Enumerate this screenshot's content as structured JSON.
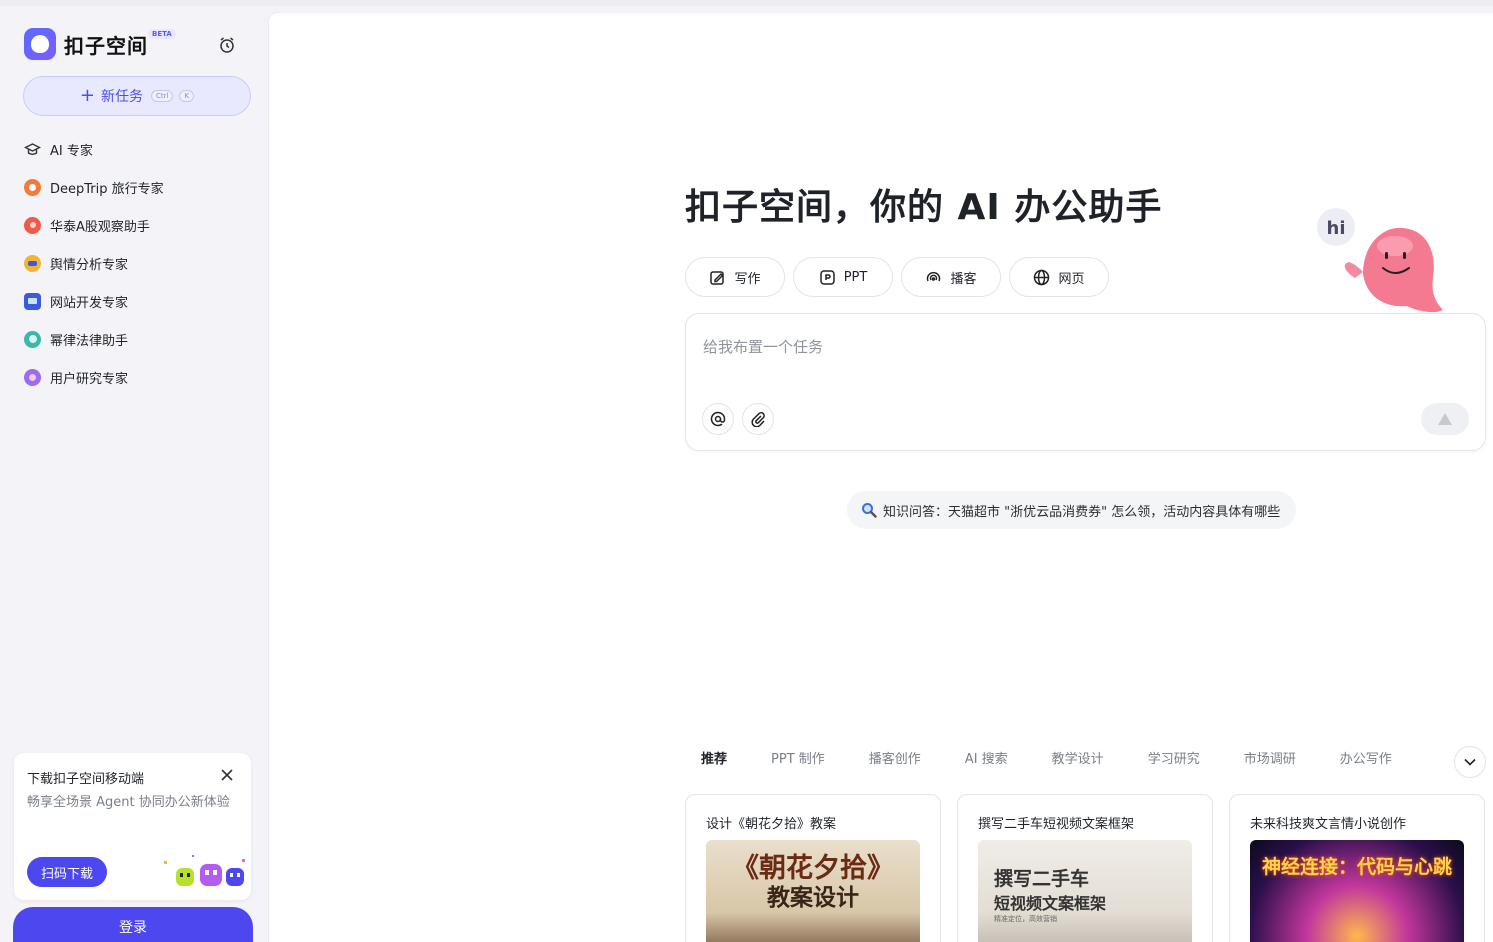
{
  "brand": {
    "name": "扣子空间",
    "badge": "BETA"
  },
  "sidebar": {
    "new_task": {
      "label": "新任务",
      "keys": [
        "Ctrl",
        "K"
      ]
    },
    "items": [
      {
        "label": "AI 专家",
        "icon": "graduation-cap-icon",
        "color": "#444"
      },
      {
        "label": "DeepTrip 旅行专家",
        "icon": "deeptrip-icon",
        "color": "#f27a3a"
      },
      {
        "label": "华泰A股观察助手",
        "icon": "huatai-icon",
        "color": "#f05a4a"
      },
      {
        "label": "舆情分析专家",
        "icon": "sentiment-icon",
        "color": "#f2b338"
      },
      {
        "label": "网站开发专家",
        "icon": "monitor-icon",
        "color": "#3b5bdb"
      },
      {
        "label": "幂律法律助手",
        "icon": "law-icon",
        "color": "#3bb8a8"
      },
      {
        "label": "用户研究专家",
        "icon": "user-research-icon",
        "color": "#9a6cf0"
      }
    ],
    "download": {
      "title": "下载扣子空间移动端",
      "desc": "畅享全场景 Agent 协同办公新体验",
      "button": "扫码下载"
    },
    "login": "登录"
  },
  "main": {
    "headline": "扣子空间，你的 AI 办公助手",
    "mascot_text": "hi",
    "tools": [
      {
        "label": "写作",
        "icon": "edit-icon"
      },
      {
        "label": "PPT",
        "icon": "ppt-icon"
      },
      {
        "label": "播客",
        "icon": "podcast-icon"
      },
      {
        "label": "网页",
        "icon": "globe-icon"
      }
    ],
    "input": {
      "placeholder": "给我布置一个任务"
    },
    "suggestion": "知识问答：天猫超市 \"浙优云品消费券\" 怎么领，活动内容具体有哪些",
    "categories": [
      "推荐",
      "PPT 制作",
      "播客创作",
      "AI 搜索",
      "教学设计",
      "学习研究",
      "市场调研",
      "办公写作"
    ],
    "cards": [
      {
        "title": "设计《朝花夕拾》教案",
        "img_line1": "《朝花夕拾》",
        "img_line2": "教案设计"
      },
      {
        "title": "撰写二手车短视频文案框架",
        "img_line1": "撰写二手车",
        "img_line2": "短视频文案框架",
        "img_line3": "精准定位，高效营销"
      },
      {
        "title": "未来科技爽文言情小说创作",
        "img_line1": "神经连接：代码与心跳"
      }
    ]
  },
  "colors": {
    "accent": "#4d47f0",
    "accent_light": "#e8e9ff"
  }
}
